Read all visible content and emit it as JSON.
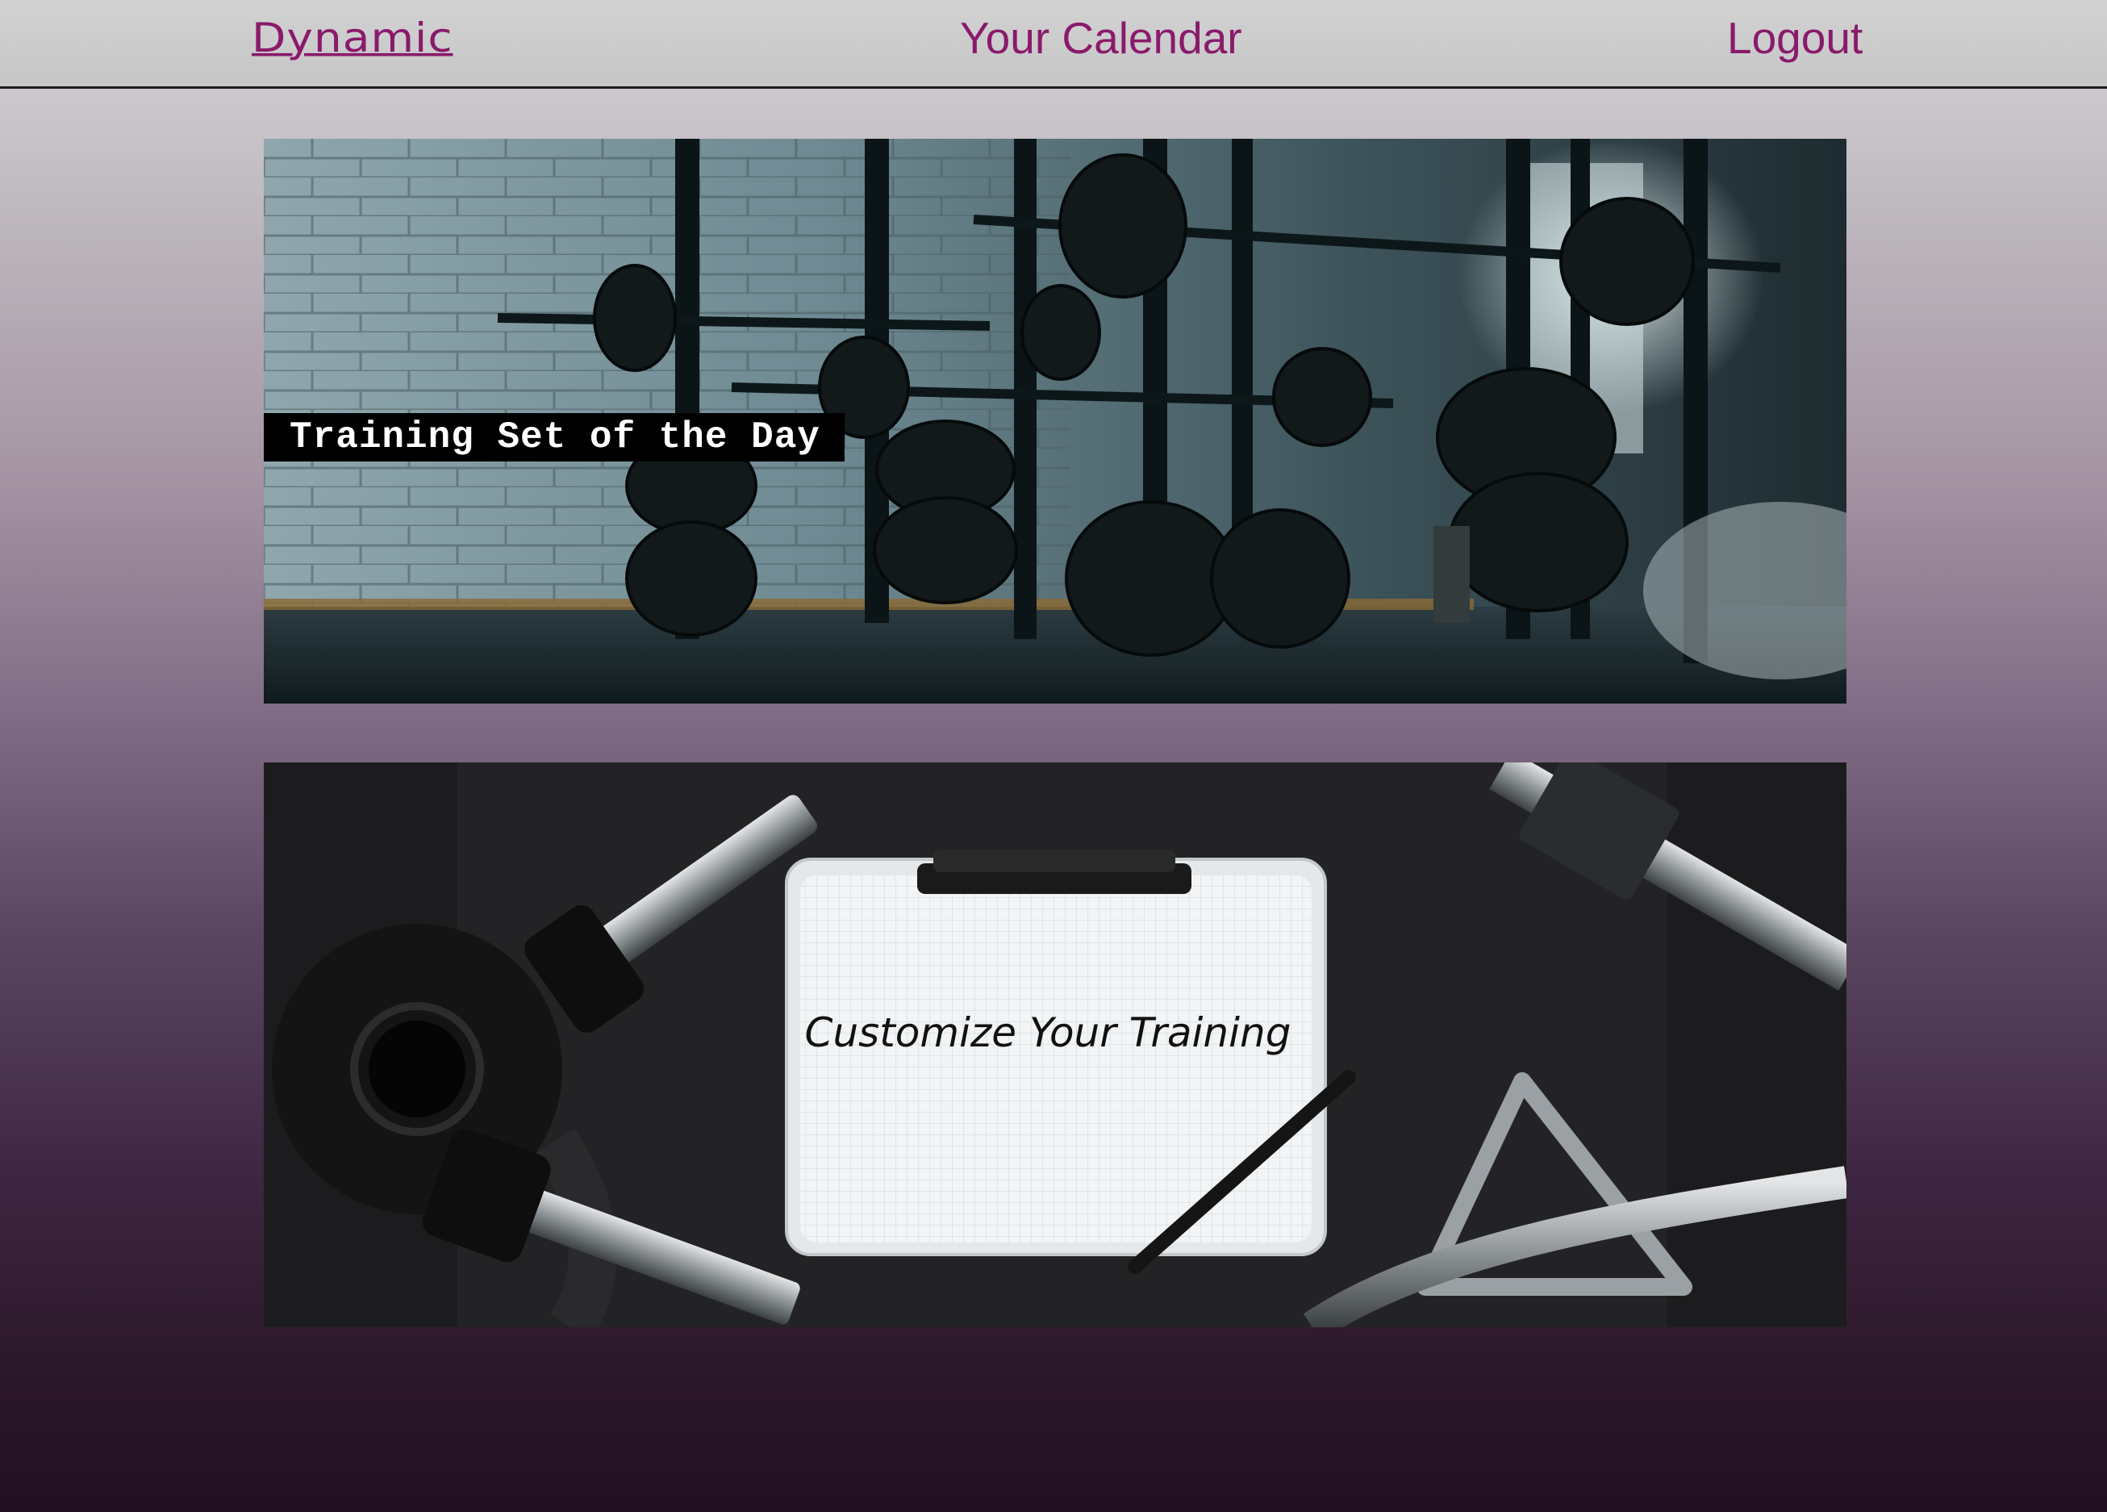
{
  "nav": {
    "brand": "Dynamic",
    "calendar": "Your Calendar",
    "logout": "Logout"
  },
  "cards": {
    "training_set": {
      "label": "Training Set of the Day",
      "image": "gym-weights-rack-photo"
    },
    "customize": {
      "label": "Customize Your Training",
      "image": "clipboard-with-dumbbells-photo"
    }
  },
  "colors": {
    "nav_link": "#8a1a6b",
    "nav_bg": "#c9c9ca",
    "page_gradient_top": "#d6d5d8",
    "page_gradient_bottom": "#220f22"
  }
}
